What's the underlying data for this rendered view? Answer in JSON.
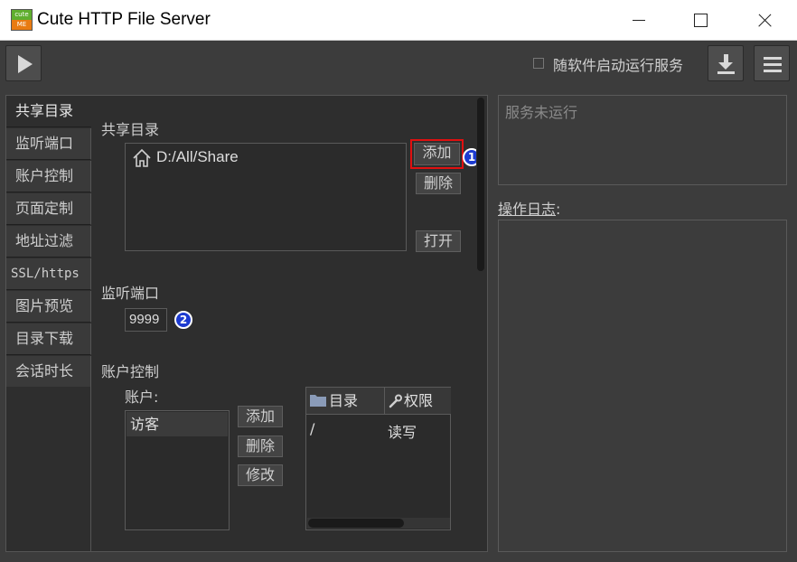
{
  "window": {
    "logo_top": "cute",
    "logo_bottom": "ME",
    "title": "Cute HTTP File Server"
  },
  "toolbar": {
    "autostart_label": "随软件启动运行服务",
    "autostart_checked": false,
    "icons": [
      "play-icon",
      "download-icon",
      "menu-icon"
    ]
  },
  "sidebar": {
    "items": [
      {
        "label": "共享目录",
        "active": true
      },
      {
        "label": "监听端口",
        "active": false
      },
      {
        "label": "账户控制",
        "active": false
      },
      {
        "label": "页面定制",
        "active": false
      },
      {
        "label": "地址过滤",
        "active": false
      },
      {
        "label": "SSL/https",
        "active": false
      },
      {
        "label": "图片预览",
        "active": false
      },
      {
        "label": "目录下载",
        "active": false
      },
      {
        "label": "会话时长",
        "active": false
      }
    ]
  },
  "share": {
    "heading": "共享目录",
    "path": "D:/All/Share",
    "add_label": "添加",
    "delete_label": "删除",
    "open_label": "打开",
    "badge": "1"
  },
  "port": {
    "heading": "监听端口",
    "value": "9999",
    "badge": "2"
  },
  "accounts": {
    "heading": "账户控制",
    "account_label": "账户:",
    "list": [
      "访客"
    ],
    "add_label": "添加",
    "delete_label": "删除",
    "edit_label": "修改",
    "perm_columns": [
      "目录",
      "权限"
    ],
    "perm_rows": [
      {
        "dir": "/",
        "perm": "读写"
      }
    ]
  },
  "status": {
    "text": "服务未运行"
  },
  "log": {
    "label_underlined": "操作日志",
    "label_suffix": ":"
  },
  "colors": {
    "highlight": "#e01010",
    "badge": "#1d3bd0",
    "logo_green": "#5fae2e",
    "logo_orange": "#e87b12"
  }
}
